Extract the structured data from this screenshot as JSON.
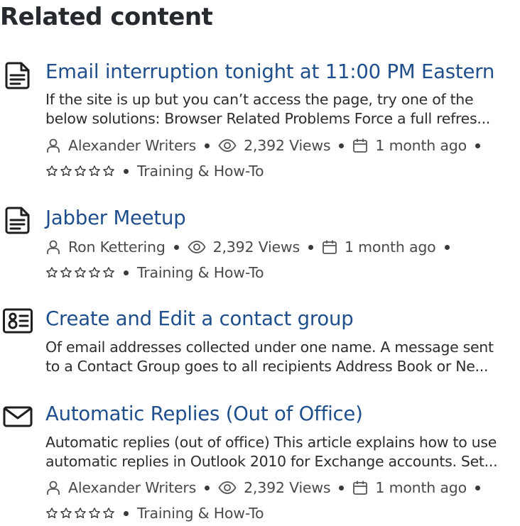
{
  "section": {
    "title": "Related content"
  },
  "items": [
    {
      "icon": "document-icon",
      "title": "Email interruption tonight at 11:00 PM Eastern",
      "excerpt_lines": [
        "If the site is up but you can’t access the page, try one of the",
        "below solutions: Browser Related Problems Force a full refres..."
      ],
      "author": "Alexander Writers",
      "views": "2,392 Views",
      "date": "1 month ago",
      "rating": 0,
      "rating_max": 5,
      "category": "Training & How-To"
    },
    {
      "icon": "document-icon",
      "title": "Jabber Meetup",
      "excerpt_lines": [],
      "author": "Ron Kettering",
      "views": "2,392 Views",
      "date": "1 month ago",
      "rating": 0,
      "rating_max": 5,
      "category": "Training & How-To"
    },
    {
      "icon": "contact-card-icon",
      "title": "Create and Edit a contact group",
      "excerpt_lines": [
        "Of email addresses collected under one name. A message sent",
        "to a Contact Group goes to all recipients Address Book or Ne..."
      ]
    },
    {
      "icon": "envelope-icon",
      "title": "Automatic Replies (Out of Office)",
      "excerpt_lines": [
        "Automatic replies (out of office) This article explains how to use",
        "automatic replies in Outlook 2010 for Exchange accounts. Set..."
      ],
      "author": "Alexander Writers",
      "views": "2,392 Views",
      "date": "1 month ago",
      "rating": 0,
      "rating_max": 5,
      "category": "Training & How-To"
    }
  ],
  "colors": {
    "link": "#1f4e8c",
    "text": "#2d2d2d",
    "meta": "#4a4a4a",
    "heading": "#262a2e"
  }
}
